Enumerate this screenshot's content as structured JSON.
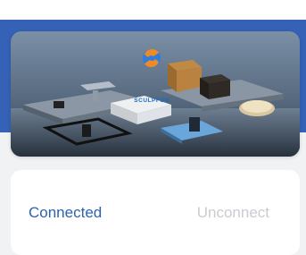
{
  "banner": {
    "logo_text": "SCULPFUN"
  },
  "connection": {
    "status_label": "Connected",
    "unconnect_label": "Unconnect"
  },
  "colors": {
    "header_blue": "#3562b6",
    "status_blue": "#2c63b0",
    "disabled_gray": "#c9ccd2"
  }
}
